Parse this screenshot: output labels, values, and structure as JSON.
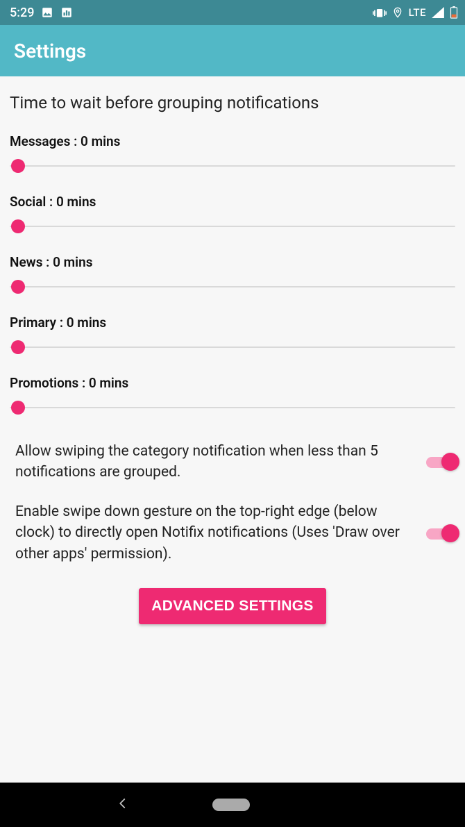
{
  "status": {
    "time": "5:29",
    "network": "LTE"
  },
  "header": {
    "title": "Settings"
  },
  "section": {
    "title": "Time to wait before grouping notifications"
  },
  "sliders": [
    {
      "label": "Messages : 0 mins",
      "value": 0
    },
    {
      "label": "Social : 0 mins",
      "value": 0
    },
    {
      "label": "News : 0 mins",
      "value": 0
    },
    {
      "label": "Primary : 0 mins",
      "value": 0
    },
    {
      "label": "Promotions : 0 mins",
      "value": 0
    }
  ],
  "toggles": [
    {
      "text": "Allow swiping the category notification when less than 5 notifications are grouped.",
      "on": true
    },
    {
      "text": "Enable swipe down gesture on the top-right edge (below clock) to directly open Notifix notifications (Uses 'Draw over other apps' permission).",
      "on": true
    }
  ],
  "button": {
    "advanced": "ADVANCED SETTINGS"
  },
  "colors": {
    "accent": "#ee2a72",
    "appbar": "#52b8c6",
    "statusbar": "#3d8994"
  }
}
